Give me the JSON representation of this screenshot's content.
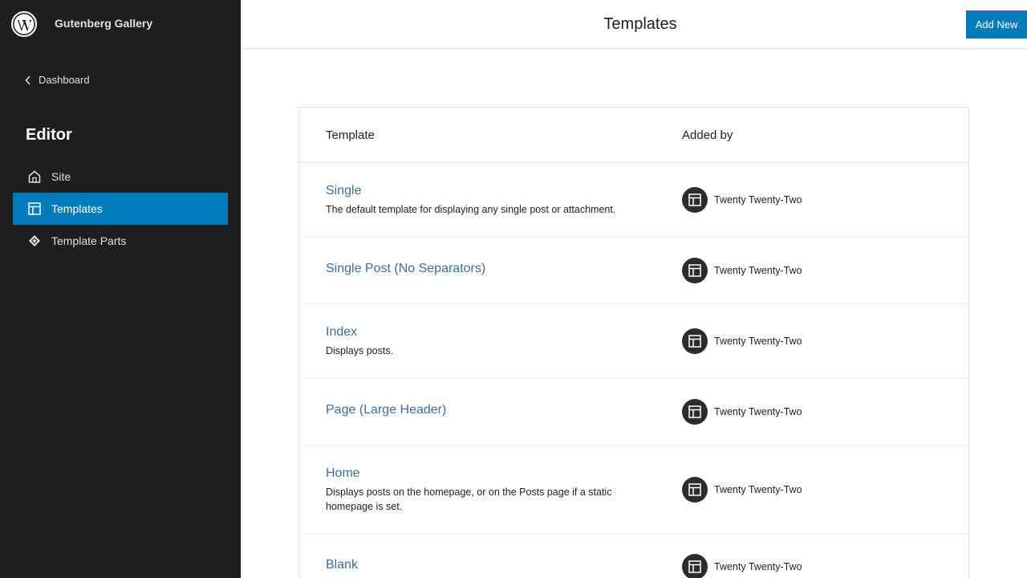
{
  "site": {
    "title": "Gutenberg Gallery"
  },
  "sidebar": {
    "back_label": "Dashboard",
    "section_title": "Editor",
    "items": [
      {
        "label": "Site",
        "icon": "home-icon",
        "active": false
      },
      {
        "label": "Templates",
        "icon": "layout-icon",
        "active": true
      },
      {
        "label": "Template Parts",
        "icon": "symbol-icon",
        "active": false
      }
    ]
  },
  "header": {
    "title": "Templates",
    "add_new_label": "Add New"
  },
  "table": {
    "columns": [
      "Template",
      "Added by"
    ],
    "rows": [
      {
        "name": "Single",
        "description": "The default template for displaying any single post or attachment.",
        "added_by": "Twenty Twenty-Two"
      },
      {
        "name": "Single Post (No Separators)",
        "description": "",
        "added_by": "Twenty Twenty-Two"
      },
      {
        "name": "Index",
        "description": "Displays posts.",
        "added_by": "Twenty Twenty-Two"
      },
      {
        "name": "Page (Large Header)",
        "description": "",
        "added_by": "Twenty Twenty-Two"
      },
      {
        "name": "Home",
        "description": "Displays posts on the homepage, or on the Posts page if a static homepage is set.",
        "added_by": "Twenty Twenty-Two"
      },
      {
        "name": "Blank",
        "description": "",
        "added_by": "Twenty Twenty-Two"
      }
    ]
  },
  "colors": {
    "sidebar_bg": "#1e1e1e",
    "accent": "#007cba",
    "link": "#3a6f9a"
  }
}
